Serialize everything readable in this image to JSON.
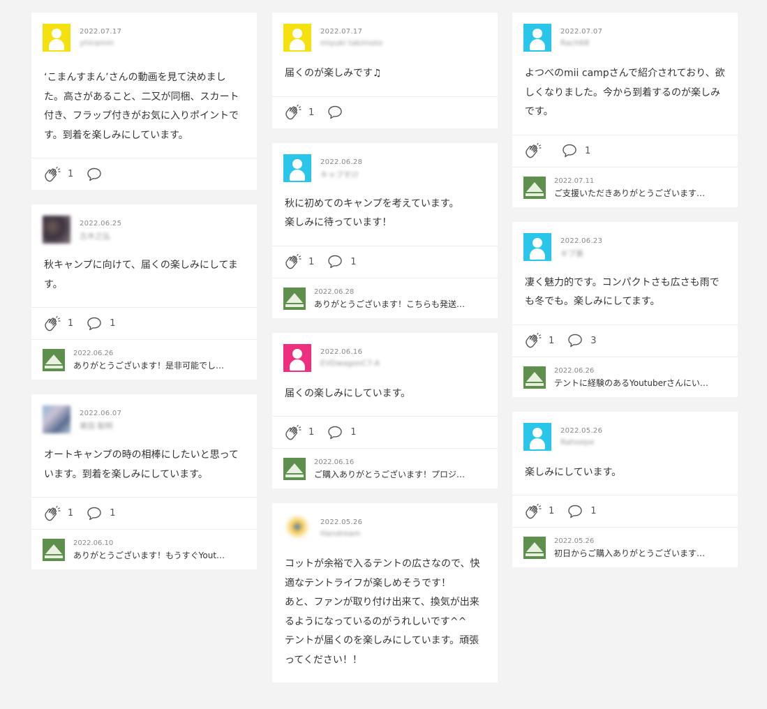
{
  "colors": {
    "background": "#f3f3f3",
    "card": "#ffffff",
    "avatar_yellow": "#f5e10f",
    "avatar_cyan": "#29c6ea",
    "avatar_pink": "#ee2f7d",
    "shop_green": "#5f8f4c"
  },
  "icons": {
    "clap": "clap-hands-icon",
    "comment": "speech-bubble-icon"
  },
  "cards": [
    {
      "date": "2022.07.17",
      "user": "yhiramm",
      "text": "‘こまんすまん’さんの動画を見て決めました。高さがあること、二又が同梱、スカート付き、フラップ付きがお気に入りポイントです。到着を楽しみにしています。",
      "likes": "1",
      "comments": "",
      "reply_date": "",
      "reply_text": ""
    },
    {
      "date": "2022.06.25",
      "user": "古木之弘",
      "text": "秋キャンプに向けて、届くの楽しみにしてます。",
      "likes": "1",
      "comments": "1",
      "reply_date": "2022.06.26",
      "reply_text": "ありがとうございます！是非可能でし…"
    },
    {
      "date": "2022.06.07",
      "user": "東田 聡明",
      "text": "オートキャンプの時の相棒にしたいと思っています。到着を楽しみにしています。",
      "likes": "1",
      "comments": "1",
      "reply_date": "2022.06.10",
      "reply_text": "ありがとうございます！もうすぐYout…"
    },
    {
      "date": "2022.07.17",
      "user": "miyuki takimoto",
      "text": "届くのが楽しみです♫",
      "likes": "1",
      "comments": "",
      "reply_date": "",
      "reply_text": ""
    },
    {
      "date": "2022.06.28",
      "user": "キャプすけ",
      "text": "秋に初めてのキャンプを考えています。\n楽しみに待っています！",
      "likes": "1",
      "comments": "1",
      "reply_date": "2022.06.28",
      "reply_text": "ありがとうございます！こちらも発送…"
    },
    {
      "date": "2022.06.16",
      "user": "EVDwagonC7-A",
      "text": "届くの楽しみにしています。",
      "likes": "1",
      "comments": "1",
      "reply_date": "2022.06.16",
      "reply_text": "ご購入ありがとうございます！プロジ…"
    },
    {
      "date": "2022.05.26",
      "user": "Handream",
      "text": "コットが余裕で入るテントの広さなので、快適なテントライフが楽しめそうです！\nあと、ファンが取り付け出来て、換気が出来るようになっているのがうれしいです^^\nテントが届くのを楽しみにしています。頑張ってください！！",
      "likes": "",
      "comments": "",
      "reply_date": "",
      "reply_text": ""
    },
    {
      "date": "2022.07.07",
      "user": "Rach68",
      "text": "よつべのmii campさんで紹介されており、欲しくなりました。今から到着するのが楽しみです。",
      "likes": "",
      "comments": "1",
      "reply_date": "2022.07.11",
      "reply_text": "ご支援いただきありがとうございます…"
    },
    {
      "date": "2022.06.23",
      "user": "ギブ美",
      "text": "凄く魅力的です。コンパクトさも広さも雨でも冬でも。楽しみにしてます。",
      "likes": "1",
      "comments": "3",
      "reply_date": "2022.06.26",
      "reply_text": "テントに経験のあるYoutuberさんにい…"
    },
    {
      "date": "2022.05.26",
      "user": "Rahoepe",
      "text": "楽しみにしています。",
      "likes": "1",
      "comments": "1",
      "reply_date": "2022.05.26",
      "reply_text": "初日からご購入ありがとうございます…"
    }
  ]
}
